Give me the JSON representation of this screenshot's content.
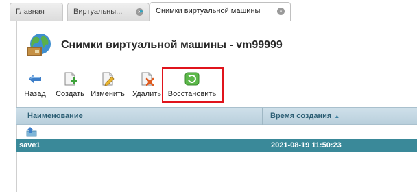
{
  "tabs": [
    {
      "label": "Главная"
    },
    {
      "label": "Виртуальны..."
    },
    {
      "label": "Снимки виртуальной машины"
    }
  ],
  "header": {
    "title": "Снимки виртуальной машины - vm99999"
  },
  "toolbar": {
    "back": "Назад",
    "create": "Создать",
    "edit": "Изменить",
    "delete": "Удалить",
    "restore": "Восстановить"
  },
  "table": {
    "columns": [
      "Наименование",
      "Время создания"
    ],
    "rows": [
      {
        "name": "save1",
        "time": "2021-08-19 11:50:23"
      }
    ]
  },
  "colors": {
    "selected_row": "#3a8999",
    "highlight_border": "#e0141c"
  }
}
